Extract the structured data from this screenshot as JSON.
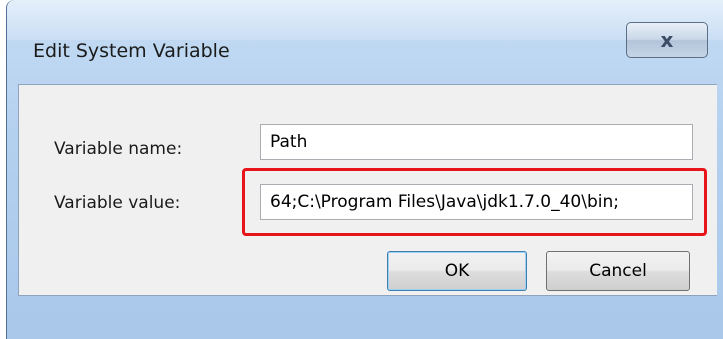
{
  "window": {
    "title": "Edit System Variable",
    "close_glyph": "x"
  },
  "form": {
    "name_label": "Variable name:",
    "name_value": "Path",
    "value_label": "Variable value:",
    "value_value": "64;C:\\Program Files\\Java\\jdk1.7.0_40\\bin;"
  },
  "buttons": {
    "ok_label": "OK",
    "cancel_label": "Cancel"
  },
  "colors": {
    "highlight": "#e8141b"
  }
}
